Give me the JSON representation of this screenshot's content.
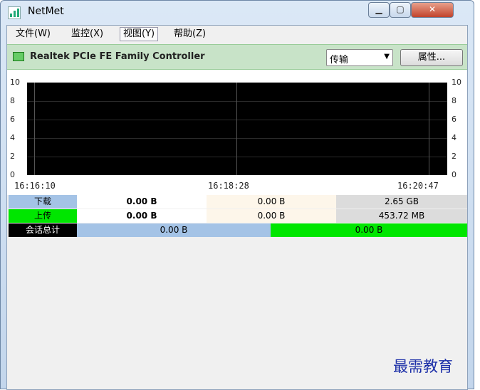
{
  "window": {
    "title": "NetMet"
  },
  "menu": {
    "items": [
      "文件(W)",
      "监控(X)",
      "视图(Y)",
      "帮助(Z)"
    ]
  },
  "adapter": {
    "name": "Realtek PCIe FE Family Controller",
    "mode": "传输",
    "props_label": "属性..."
  },
  "graph": {
    "y_ticks": [
      "10",
      "8",
      "6",
      "4",
      "2",
      "0"
    ],
    "x_ticks": [
      "16:16:10",
      "16:18:28",
      "16:20:47"
    ],
    "background": "#000000"
  },
  "stats": {
    "download": {
      "label": "下载",
      "current": "0.00 B",
      "average": "0.00 B",
      "total": "2.65 GB"
    },
    "upload": {
      "label": "上传",
      "current": "0.00 B",
      "average": "0.00 B",
      "total": "453.72 MB"
    },
    "session": {
      "label": "会话总计",
      "download": "0.00 B",
      "upload": "0.00 B"
    }
  },
  "colors": {
    "download": "#a4c3e6",
    "upload": "#00e600",
    "adapter_bar": "#c8e3c8"
  },
  "watermark": "最需教育"
}
